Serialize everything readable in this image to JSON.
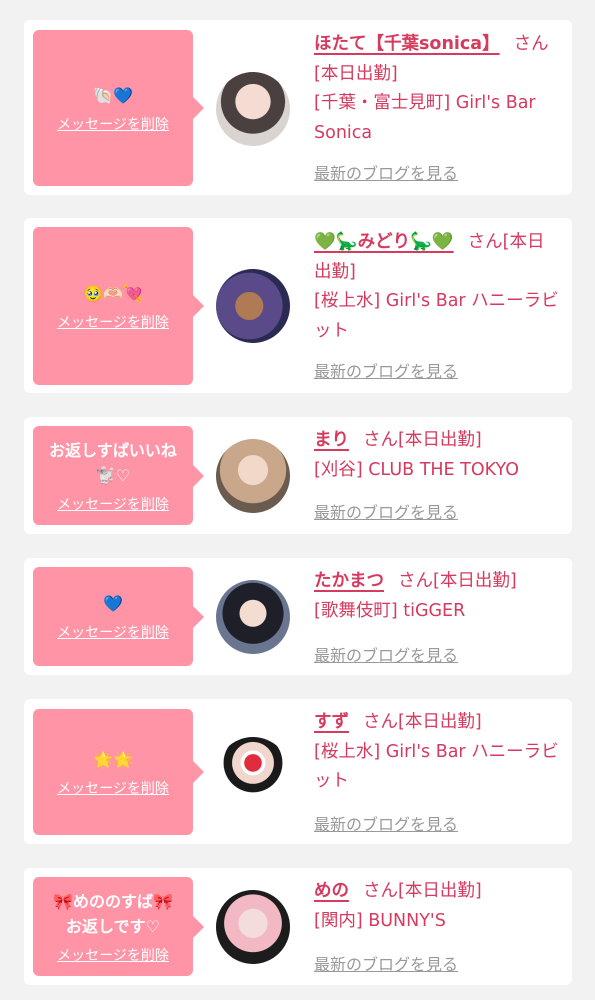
{
  "colors": {
    "accent": "#d63a5e",
    "bubble": "#ff94a7",
    "background": "#f2f2f2"
  },
  "entries": [
    {
      "message": "🐚💙",
      "delete_label": "メッセージを削除",
      "name": "ほたて【千葉sonica】",
      "suffix": "さん[本日出勤]",
      "location": "[千葉・富士見町] Girl's Bar Sonica",
      "blog_label": "最新のブログを見る"
    },
    {
      "message": "🥹🫶🏻💘",
      "delete_label": "メッセージを削除",
      "name": "💚🦕みどり🦕💚",
      "suffix": "さん[本日出勤]",
      "location": "[桜上水] Girl's Bar ハニーラビット",
      "blog_label": "最新のブログを見る"
    },
    {
      "message": "お返しすぱいいね\n🐩♡",
      "delete_label": "メッセージを削除",
      "name": "まり",
      "suffix": "さん[本日出勤]",
      "location": "[刈谷] CLUB THE TOKYO",
      "blog_label": "最新のブログを見る"
    },
    {
      "message": "💙",
      "delete_label": "メッセージを削除",
      "name": "たかまつ",
      "suffix": "さん[本日出勤]",
      "location": "[歌舞伎町] tiGGER",
      "blog_label": "最新のブログを見る"
    },
    {
      "message": "🌟🌟",
      "delete_label": "メッセージを削除",
      "name": "すず",
      "suffix": "さん[本日出勤]",
      "location": "[桜上水] Girl's Bar ハニーラビット",
      "blog_label": "最新のブログを見る"
    },
    {
      "message": "🎀めののすば🎀\nお返しです♡",
      "delete_label": "メッセージを削除",
      "name": "めの",
      "suffix": "さん[本日出勤]",
      "location": "[関内] BUNNY'S",
      "blog_label": "最新のブログを見る"
    }
  ]
}
